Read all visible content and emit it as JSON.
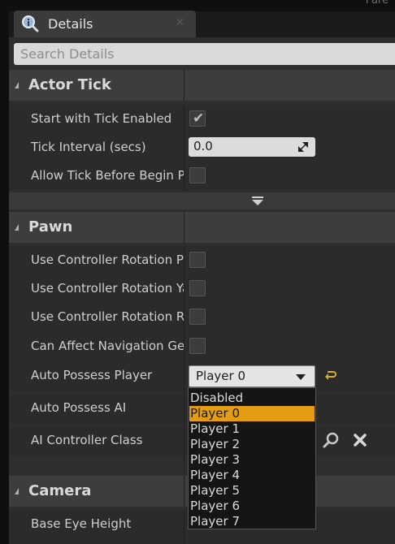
{
  "topbar": {
    "clipped_text": "Pare"
  },
  "tab": {
    "label": "Details",
    "close": "×"
  },
  "search": {
    "placeholder": "Search Details"
  },
  "categories": {
    "actor_tick": "Actor Tick",
    "pawn": "Pawn",
    "camera": "Camera"
  },
  "actor_tick": {
    "start_with_tick": {
      "label": "Start with Tick Enabled",
      "checked": true
    },
    "tick_interval": {
      "label": "Tick Interval (secs)",
      "value": "0.0"
    },
    "allow_tick_before_begin_play": {
      "label": "Allow Tick Before Begin Play",
      "checked": false
    }
  },
  "pawn": {
    "use_ctrl_rot_pitch": {
      "label": "Use Controller Rotation Pitch",
      "checked": false
    },
    "use_ctrl_rot_yaw": {
      "label": "Use Controller Rotation Yaw",
      "checked": false
    },
    "use_ctrl_rot_roll": {
      "label": "Use Controller Rotation Roll",
      "checked": false
    },
    "can_affect_nav": {
      "label": "Can Affect Navigation Generation",
      "checked": false
    },
    "auto_possess_player": {
      "label": "Auto Possess Player",
      "value": "Player 0"
    },
    "auto_possess_ai": {
      "label": "Auto Possess AI"
    },
    "ai_controller_class": {
      "label": "AI Controller Class"
    }
  },
  "camera": {
    "base_eye_height": {
      "label": "Base Eye Height"
    }
  },
  "dropdown": {
    "options": [
      "Disabled",
      "Player 0",
      "Player 1",
      "Player 2",
      "Player 3",
      "Player 4",
      "Player 5",
      "Player 6",
      "Player 7"
    ],
    "selected": "Player 0"
  },
  "icons": {
    "tab_icon": "details-magnifier-icon",
    "reset": "reset-to-default-icon",
    "browse": "search-icon",
    "clear": "clear-icon",
    "expander": "advanced-expander-icon"
  },
  "colors": {
    "selection": "#e39d12",
    "panel_bg": "#2e2e2e",
    "category_bg": "#3d3d3d"
  }
}
